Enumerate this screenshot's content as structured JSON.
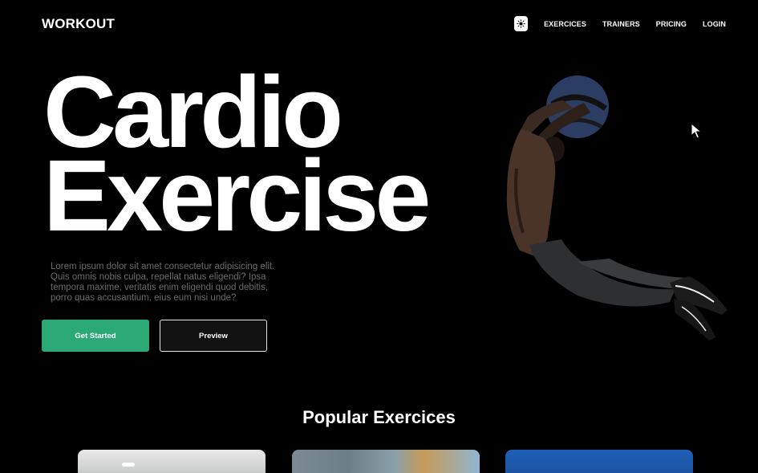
{
  "header": {
    "logo": "WORKOUT",
    "nav": [
      {
        "label": "EXERCICES"
      },
      {
        "label": "TRAINERS"
      },
      {
        "label": "PRICING"
      },
      {
        "label": "LOGIN"
      }
    ],
    "theme_toggle_icon": "sun-icon"
  },
  "hero": {
    "title_line1": "Cardio",
    "title_line2": "Exercise",
    "description": "Lorem ipsum dolor sit amet consectetur adipisicing elit. Quis omnis nobis culpa, repellat natus eligendi? Ipsa tempora maxime, veritatis enim eligendi quod debitis, porro quas accusantium, eius eum nisi unde?",
    "primary_button": "Get Started",
    "secondary_button": "Preview"
  },
  "popular": {
    "title": "Popular Exercices"
  },
  "colors": {
    "background": "#000000",
    "accent": "#2aa875",
    "muted_text": "#6c6c6c"
  }
}
